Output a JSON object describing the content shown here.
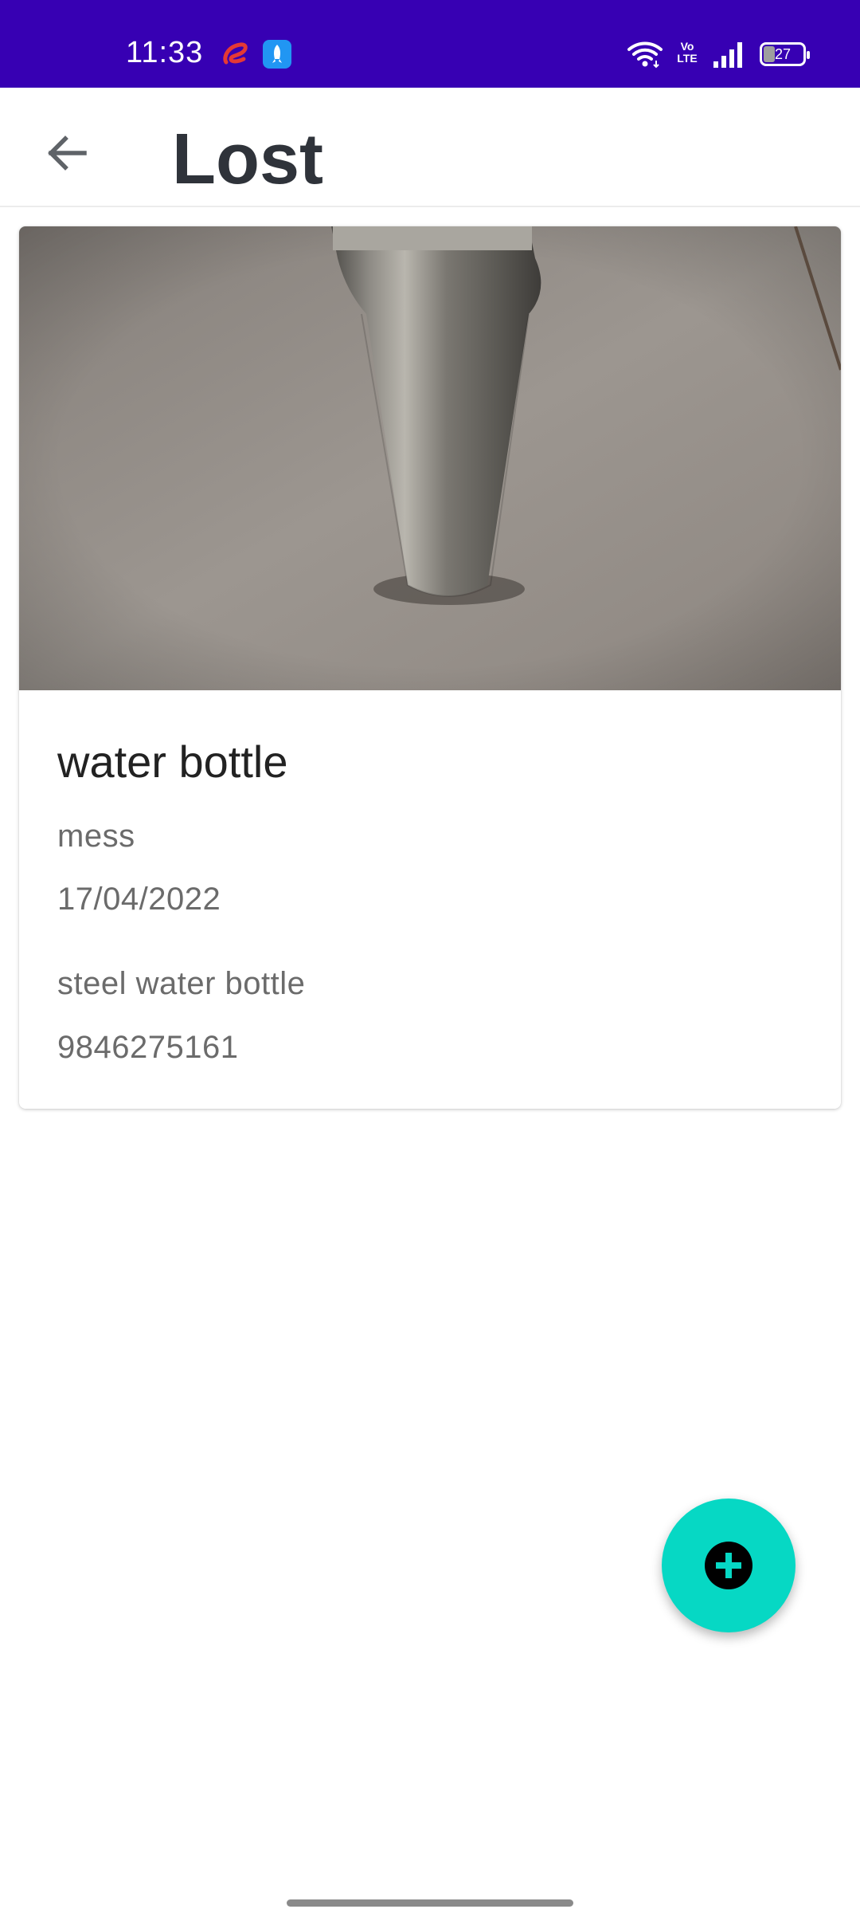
{
  "status_bar": {
    "time": "11:33",
    "battery": "27",
    "volte_text": "Vo LTE",
    "icons": [
      "airtel-icon",
      "rocket-app-icon",
      "wifi-icon",
      "volte-icon",
      "signal-icon",
      "battery-icon"
    ],
    "background_color": "#3700b3"
  },
  "app_bar": {
    "title": "Lost",
    "back_icon": "arrow-left-icon"
  },
  "item": {
    "title": "water bottle",
    "location": "mess",
    "date": "17/04/2022",
    "description": "steel water bottle",
    "phone": "9846275161",
    "image_alt": "steel water bottle photo"
  },
  "fab": {
    "icon": "add-circle-icon",
    "color": "#06d8c4"
  }
}
